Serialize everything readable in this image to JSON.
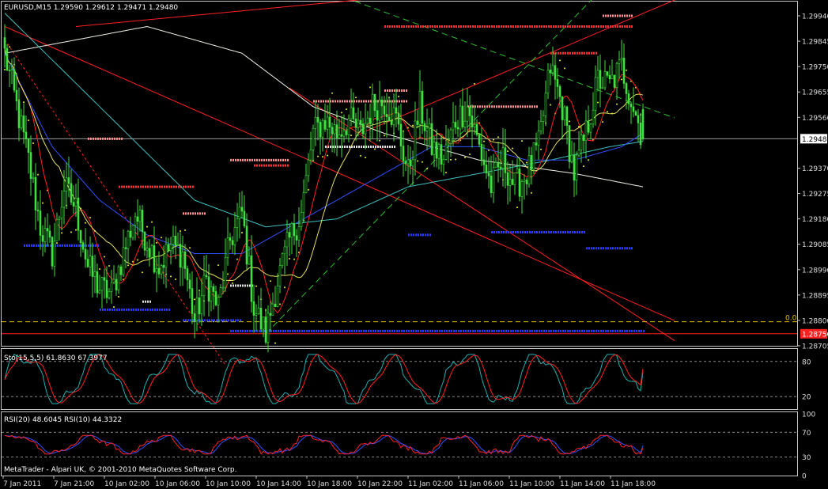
{
  "chart_data": [
    {
      "type": "candlestick",
      "panel": "price",
      "title": "EURUSD,M15  1.29590 1.29612 1.29471 1.29480",
      "symbol": "EURUSD",
      "timeframe": "M15",
      "ohlc": {
        "open": 1.2959,
        "high": 1.29612,
        "low": 1.29471,
        "close": 1.2948
      },
      "ylim": [
        1.28705,
        1.2994
      ],
      "y_ticks": [
        "1.29940",
        "1.29845",
        "1.29750",
        "1.29655",
        "1.29560",
        "1.29480",
        "1.29370",
        "1.29275",
        "1.29180",
        "1.29085",
        "1.28990",
        "1.28895",
        "1.28800",
        "1.28705"
      ],
      "current_price_label": "1.29480",
      "fib_level_label": "0.0",
      "fib_price_label": "1.28750",
      "x_tick_labels": [
        "7 Jan 2011",
        "7 Jan 21:00",
        "10 Jan 02:00",
        "10 Jan 06:00",
        "10 Jan 10:00",
        "10 Jan 14:00",
        "10 Jan 18:00",
        "10 Jan 22:00",
        "11 Jan 02:00",
        "11 Jan 06:00",
        "11 Jan 10:00",
        "11 Jan 14:00",
        "11 Jan 18:00"
      ],
      "anchors": [
        [
          0,
          1.298
        ],
        [
          5,
          1.296
        ],
        [
          10,
          1.294
        ],
        [
          15,
          1.2915
        ],
        [
          20,
          1.2905
        ],
        [
          25,
          1.293
        ],
        [
          30,
          1.2922
        ],
        [
          35,
          1.29
        ],
        [
          40,
          1.2892
        ],
        [
          45,
          1.289
        ],
        [
          50,
          1.2905
        ],
        [
          55,
          1.292
        ],
        [
          60,
          1.291
        ],
        [
          65,
          1.29
        ],
        [
          70,
          1.2908
        ],
        [
          75,
          1.2905
        ],
        [
          80,
          1.288
        ],
        [
          85,
          1.2895
        ],
        [
          90,
          1.2885
        ],
        [
          95,
          1.291
        ],
        [
          100,
          1.292
        ],
        [
          105,
          1.2885
        ],
        [
          110,
          1.2875
        ],
        [
          115,
          1.2895
        ],
        [
          120,
          1.291
        ],
        [
          125,
          1.292
        ],
        [
          130,
          1.295
        ],
        [
          135,
          1.2955
        ],
        [
          140,
          1.295
        ],
        [
          145,
          1.2955
        ],
        [
          150,
          1.295
        ],
        [
          155,
          1.296
        ],
        [
          160,
          1.2962
        ],
        [
          165,
          1.2955
        ],
        [
          170,
          1.2935
        ],
        [
          175,
          1.296
        ],
        [
          180,
          1.2945
        ],
        [
          185,
          1.294
        ],
        [
          190,
          1.2955
        ],
        [
          195,
          1.296
        ],
        [
          200,
          1.2945
        ],
        [
          205,
          1.293
        ],
        [
          210,
          1.294
        ],
        [
          215,
          1.293
        ],
        [
          220,
          1.2935
        ],
        [
          225,
          1.2945
        ],
        [
          230,
          1.2975
        ],
        [
          235,
          1.296
        ],
        [
          240,
          1.2935
        ],
        [
          245,
          1.295
        ],
        [
          250,
          1.297
        ],
        [
          255,
          1.2968
        ],
        [
          260,
          1.2975
        ],
        [
          265,
          1.296
        ],
        [
          269,
          1.2948
        ]
      ],
      "blue_ma": [
        [
          0,
          1.298
        ],
        [
          20,
          1.2945
        ],
        [
          40,
          1.2925
        ],
        [
          60,
          1.2912
        ],
        [
          80,
          1.2905
        ],
        [
          100,
          1.2905
        ],
        [
          120,
          1.2915
        ],
        [
          140,
          1.2925
        ],
        [
          160,
          1.2935
        ],
        [
          180,
          1.2945
        ],
        [
          200,
          1.2945
        ],
        [
          220,
          1.294
        ],
        [
          240,
          1.294
        ],
        [
          260,
          1.2945
        ],
        [
          269,
          1.295
        ]
      ],
      "aqua_ma": [
        [
          0,
          1.2995
        ],
        [
          40,
          1.296
        ],
        [
          80,
          1.2925
        ],
        [
          110,
          1.2915
        ],
        [
          140,
          1.2918
        ],
        [
          170,
          1.293
        ],
        [
          200,
          1.2935
        ],
        [
          230,
          1.294
        ],
        [
          255,
          1.2945
        ],
        [
          269,
          1.2947
        ]
      ],
      "white_ma": [
        [
          0,
          1.298
        ],
        [
          60,
          1.299
        ],
        [
          100,
          1.298
        ],
        [
          130,
          1.296
        ],
        [
          160,
          1.295
        ],
        [
          200,
          1.294
        ],
        [
          240,
          1.2935
        ],
        [
          269,
          1.293
        ]
      ],
      "fib_price": 1.2875,
      "yellow_dash_price": 1.28795
    },
    {
      "type": "line",
      "panel": "stochastic",
      "title": "Sto(15,5,5) 61.8630 67.3977",
      "series": [
        {
          "name": "61.8630",
          "color": "#20B0B0"
        },
        {
          "name": "67.3977",
          "color": "#FF2020"
        }
      ],
      "ylim": [
        0,
        100
      ],
      "levels": [
        80,
        20
      ],
      "y_ticks": [
        "80",
        "20"
      ]
    },
    {
      "type": "line",
      "panel": "rsi",
      "title": "RSI(20) 48.6045  RSI(10) 44.3322",
      "series": [
        {
          "name": "RSI(20)",
          "value": 48.6045,
          "color": "#3050FF"
        },
        {
          "name": "RSI(10)",
          "value": 44.3322,
          "color": "#FF2020"
        }
      ],
      "ylim": [
        0,
        100
      ],
      "levels": [
        70,
        30
      ],
      "y_ticks": [
        "100",
        "70",
        "30",
        "0"
      ]
    }
  ],
  "footer": {
    "copyright": "MetaTrader - Alpari UK, © 2001-2010 MetaQuotes Software Corp."
  }
}
